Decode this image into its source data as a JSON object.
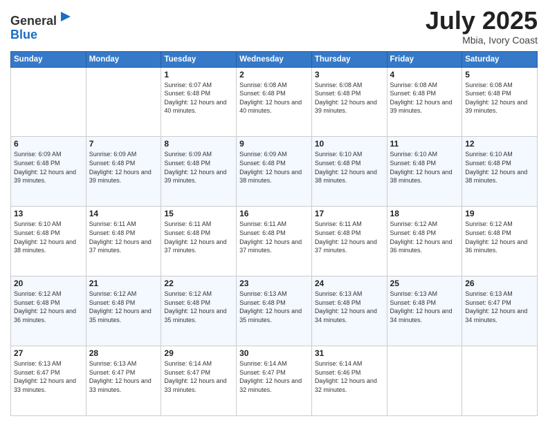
{
  "header": {
    "logo_line1": "General",
    "logo_line2": "Blue",
    "title": "July 2025",
    "location": "Mbia, Ivory Coast"
  },
  "weekdays": [
    "Sunday",
    "Monday",
    "Tuesday",
    "Wednesday",
    "Thursday",
    "Friday",
    "Saturday"
  ],
  "weeks": [
    [
      {
        "day": "",
        "info": ""
      },
      {
        "day": "",
        "info": ""
      },
      {
        "day": "1",
        "info": "Sunrise: 6:07 AM\nSunset: 6:48 PM\nDaylight: 12 hours and 40 minutes."
      },
      {
        "day": "2",
        "info": "Sunrise: 6:08 AM\nSunset: 6:48 PM\nDaylight: 12 hours and 40 minutes."
      },
      {
        "day": "3",
        "info": "Sunrise: 6:08 AM\nSunset: 6:48 PM\nDaylight: 12 hours and 39 minutes."
      },
      {
        "day": "4",
        "info": "Sunrise: 6:08 AM\nSunset: 6:48 PM\nDaylight: 12 hours and 39 minutes."
      },
      {
        "day": "5",
        "info": "Sunrise: 6:08 AM\nSunset: 6:48 PM\nDaylight: 12 hours and 39 minutes."
      }
    ],
    [
      {
        "day": "6",
        "info": "Sunrise: 6:09 AM\nSunset: 6:48 PM\nDaylight: 12 hours and 39 minutes."
      },
      {
        "day": "7",
        "info": "Sunrise: 6:09 AM\nSunset: 6:48 PM\nDaylight: 12 hours and 39 minutes."
      },
      {
        "day": "8",
        "info": "Sunrise: 6:09 AM\nSunset: 6:48 PM\nDaylight: 12 hours and 39 minutes."
      },
      {
        "day": "9",
        "info": "Sunrise: 6:09 AM\nSunset: 6:48 PM\nDaylight: 12 hours and 38 minutes."
      },
      {
        "day": "10",
        "info": "Sunrise: 6:10 AM\nSunset: 6:48 PM\nDaylight: 12 hours and 38 minutes."
      },
      {
        "day": "11",
        "info": "Sunrise: 6:10 AM\nSunset: 6:48 PM\nDaylight: 12 hours and 38 minutes."
      },
      {
        "day": "12",
        "info": "Sunrise: 6:10 AM\nSunset: 6:48 PM\nDaylight: 12 hours and 38 minutes."
      }
    ],
    [
      {
        "day": "13",
        "info": "Sunrise: 6:10 AM\nSunset: 6:48 PM\nDaylight: 12 hours and 38 minutes."
      },
      {
        "day": "14",
        "info": "Sunrise: 6:11 AM\nSunset: 6:48 PM\nDaylight: 12 hours and 37 minutes."
      },
      {
        "day": "15",
        "info": "Sunrise: 6:11 AM\nSunset: 6:48 PM\nDaylight: 12 hours and 37 minutes."
      },
      {
        "day": "16",
        "info": "Sunrise: 6:11 AM\nSunset: 6:48 PM\nDaylight: 12 hours and 37 minutes."
      },
      {
        "day": "17",
        "info": "Sunrise: 6:11 AM\nSunset: 6:48 PM\nDaylight: 12 hours and 37 minutes."
      },
      {
        "day": "18",
        "info": "Sunrise: 6:12 AM\nSunset: 6:48 PM\nDaylight: 12 hours and 36 minutes."
      },
      {
        "day": "19",
        "info": "Sunrise: 6:12 AM\nSunset: 6:48 PM\nDaylight: 12 hours and 36 minutes."
      }
    ],
    [
      {
        "day": "20",
        "info": "Sunrise: 6:12 AM\nSunset: 6:48 PM\nDaylight: 12 hours and 36 minutes."
      },
      {
        "day": "21",
        "info": "Sunrise: 6:12 AM\nSunset: 6:48 PM\nDaylight: 12 hours and 35 minutes."
      },
      {
        "day": "22",
        "info": "Sunrise: 6:12 AM\nSunset: 6:48 PM\nDaylight: 12 hours and 35 minutes."
      },
      {
        "day": "23",
        "info": "Sunrise: 6:13 AM\nSunset: 6:48 PM\nDaylight: 12 hours and 35 minutes."
      },
      {
        "day": "24",
        "info": "Sunrise: 6:13 AM\nSunset: 6:48 PM\nDaylight: 12 hours and 34 minutes."
      },
      {
        "day": "25",
        "info": "Sunrise: 6:13 AM\nSunset: 6:48 PM\nDaylight: 12 hours and 34 minutes."
      },
      {
        "day": "26",
        "info": "Sunrise: 6:13 AM\nSunset: 6:47 PM\nDaylight: 12 hours and 34 minutes."
      }
    ],
    [
      {
        "day": "27",
        "info": "Sunrise: 6:13 AM\nSunset: 6:47 PM\nDaylight: 12 hours and 33 minutes."
      },
      {
        "day": "28",
        "info": "Sunrise: 6:13 AM\nSunset: 6:47 PM\nDaylight: 12 hours and 33 minutes."
      },
      {
        "day": "29",
        "info": "Sunrise: 6:14 AM\nSunset: 6:47 PM\nDaylight: 12 hours and 33 minutes."
      },
      {
        "day": "30",
        "info": "Sunrise: 6:14 AM\nSunset: 6:47 PM\nDaylight: 12 hours and 32 minutes."
      },
      {
        "day": "31",
        "info": "Sunrise: 6:14 AM\nSunset: 6:46 PM\nDaylight: 12 hours and 32 minutes."
      },
      {
        "day": "",
        "info": ""
      },
      {
        "day": "",
        "info": ""
      }
    ]
  ]
}
